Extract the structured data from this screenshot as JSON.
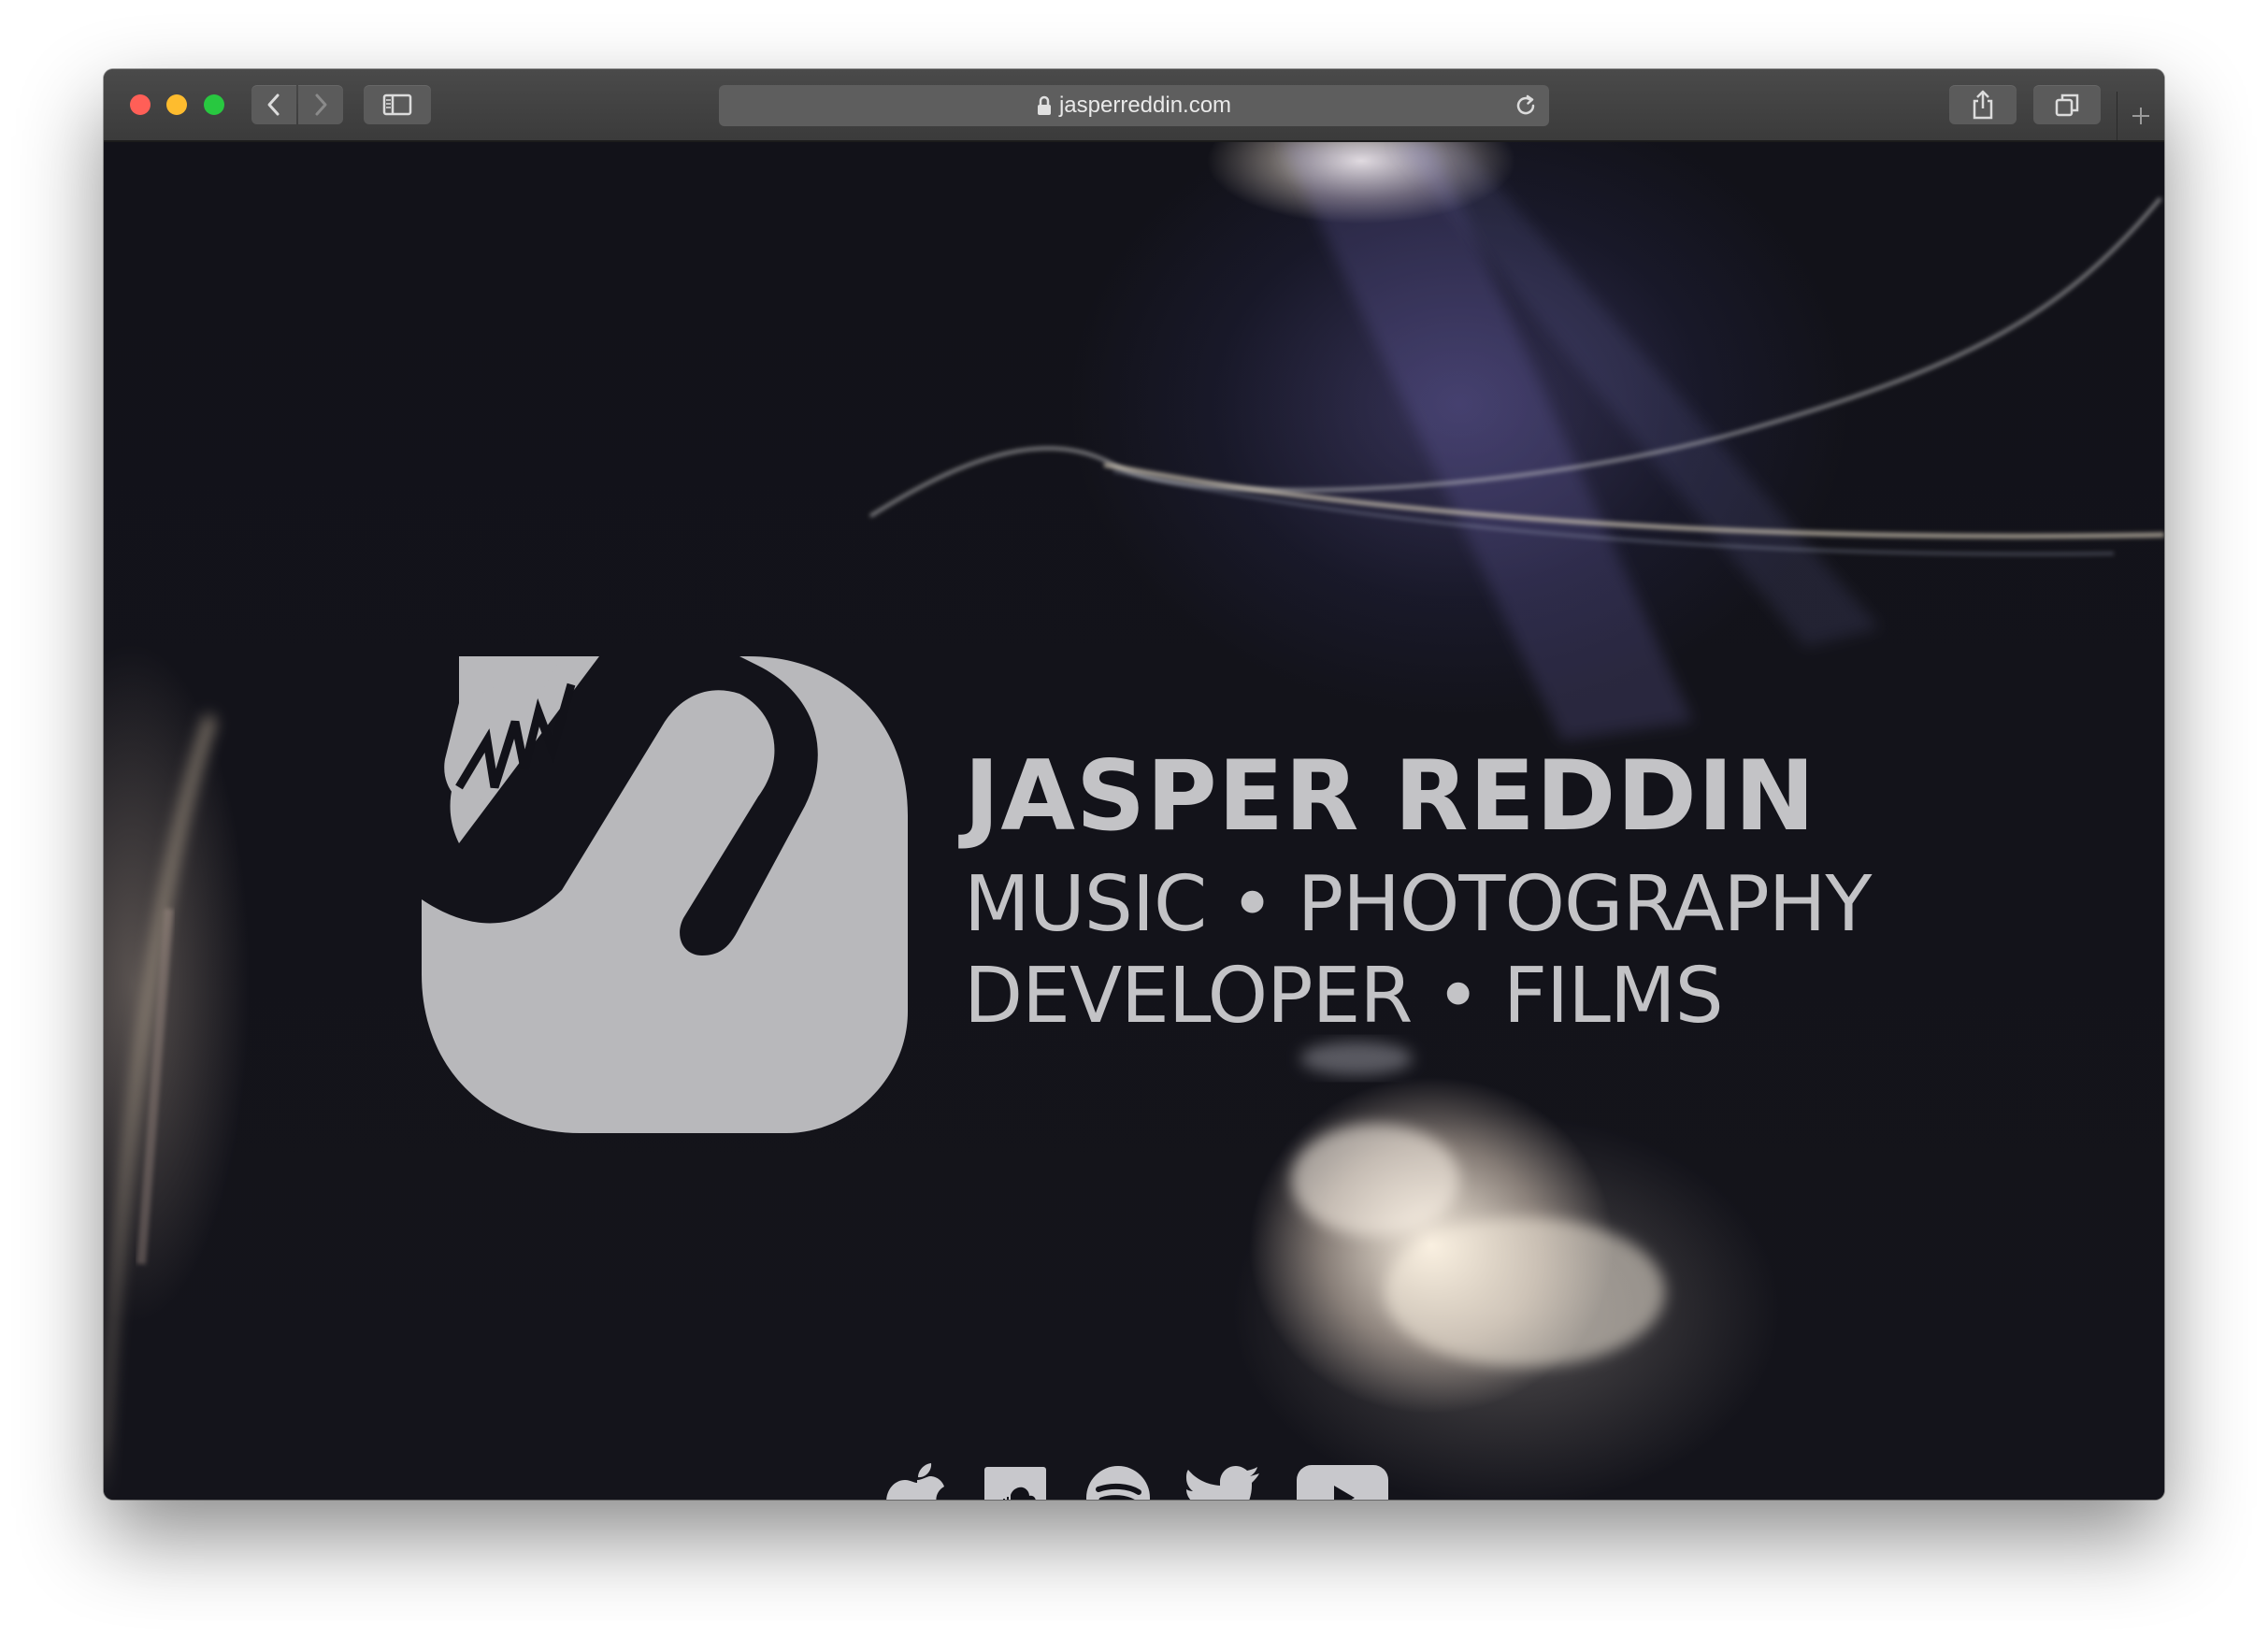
{
  "browser": {
    "url": "jasperreddin.com",
    "icons": {
      "back": "chevron-left-icon",
      "forward": "chevron-right-icon",
      "sidebar": "sidebar-icon",
      "lock": "lock-icon",
      "reload": "reload-icon",
      "share": "share-icon",
      "tabs": "tabs-overview-icon",
      "new_tab": "plus-icon"
    }
  },
  "site": {
    "name": "JASPER REDDIN",
    "tagline_line1": "MUSIC • PHOTOGRAPHY",
    "tagline_line2": "DEVELOPER • FILMS",
    "logo": "jr-monogram-logo",
    "text_color": "#c3c3c6",
    "social_links": [
      {
        "icon": "apple-music-icon"
      },
      {
        "icon": "soundcloud-icon"
      },
      {
        "icon": "spotify-icon"
      },
      {
        "icon": "twitter-icon"
      },
      {
        "icon": "youtube-icon"
      }
    ]
  }
}
